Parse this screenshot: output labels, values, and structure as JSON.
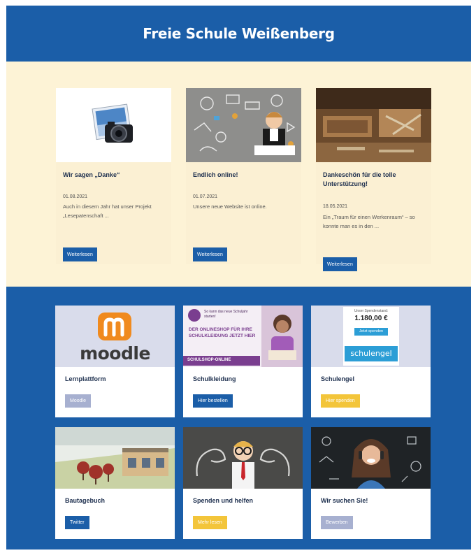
{
  "header": {
    "title": "Freie Schule Weißenberg"
  },
  "news": [
    {
      "title": "Wir sagen „Danke“",
      "date": "01.08.2021",
      "excerpt": "Auch in diesem Jahr hat unser Projekt „Lesepatenschaft ...",
      "button": "Weiterlesen"
    },
    {
      "title": "Endlich online!",
      "date": "01.07.2021",
      "excerpt": "Unsere neue Website ist online.",
      "button": "Weiterlesen"
    },
    {
      "title": "Dankeschön für die tolle Unterstützung!",
      "date": "18.05.2021",
      "excerpt": "Ein „Traum für einen Werkenraum“ – so konnte man es in den ...",
      "button": "Weiterlesen"
    }
  ],
  "tiles": [
    {
      "label": "Lernplattform",
      "button": "Moodle",
      "button_color": "#a7b0d0",
      "logo_text": "moodle"
    },
    {
      "label": "Schulkleidung",
      "button": "Hier bestellen",
      "button_color": "#1b5ea8",
      "ad": {
        "line1": "So kann das neue Schuljahr starten!",
        "line2": "DER ONLINESHOP FÜR IHRE SCHULKLEIDUNG JETZT HIER",
        "line3": "SCHULSHOP-ONLINE"
      }
    },
    {
      "label": "Schulengel",
      "button": "Hier spenden",
      "button_color": "#f3c53a",
      "ad": {
        "caption": "Unser Spendenstand:",
        "amount": "1.180,00 €",
        "cta": "Jetzt spenden",
        "brand": "schulengel"
      }
    },
    {
      "label": "Bautagebuch",
      "button": "Twitter",
      "button_color": "#1b5ea8"
    },
    {
      "label": "Spenden und helfen",
      "button": "Mehr lesen",
      "button_color": "#f3c53a"
    },
    {
      "label": "Wir suchen Sie!",
      "button": "Bewerben",
      "button_color": "#a7b0d0"
    }
  ]
}
